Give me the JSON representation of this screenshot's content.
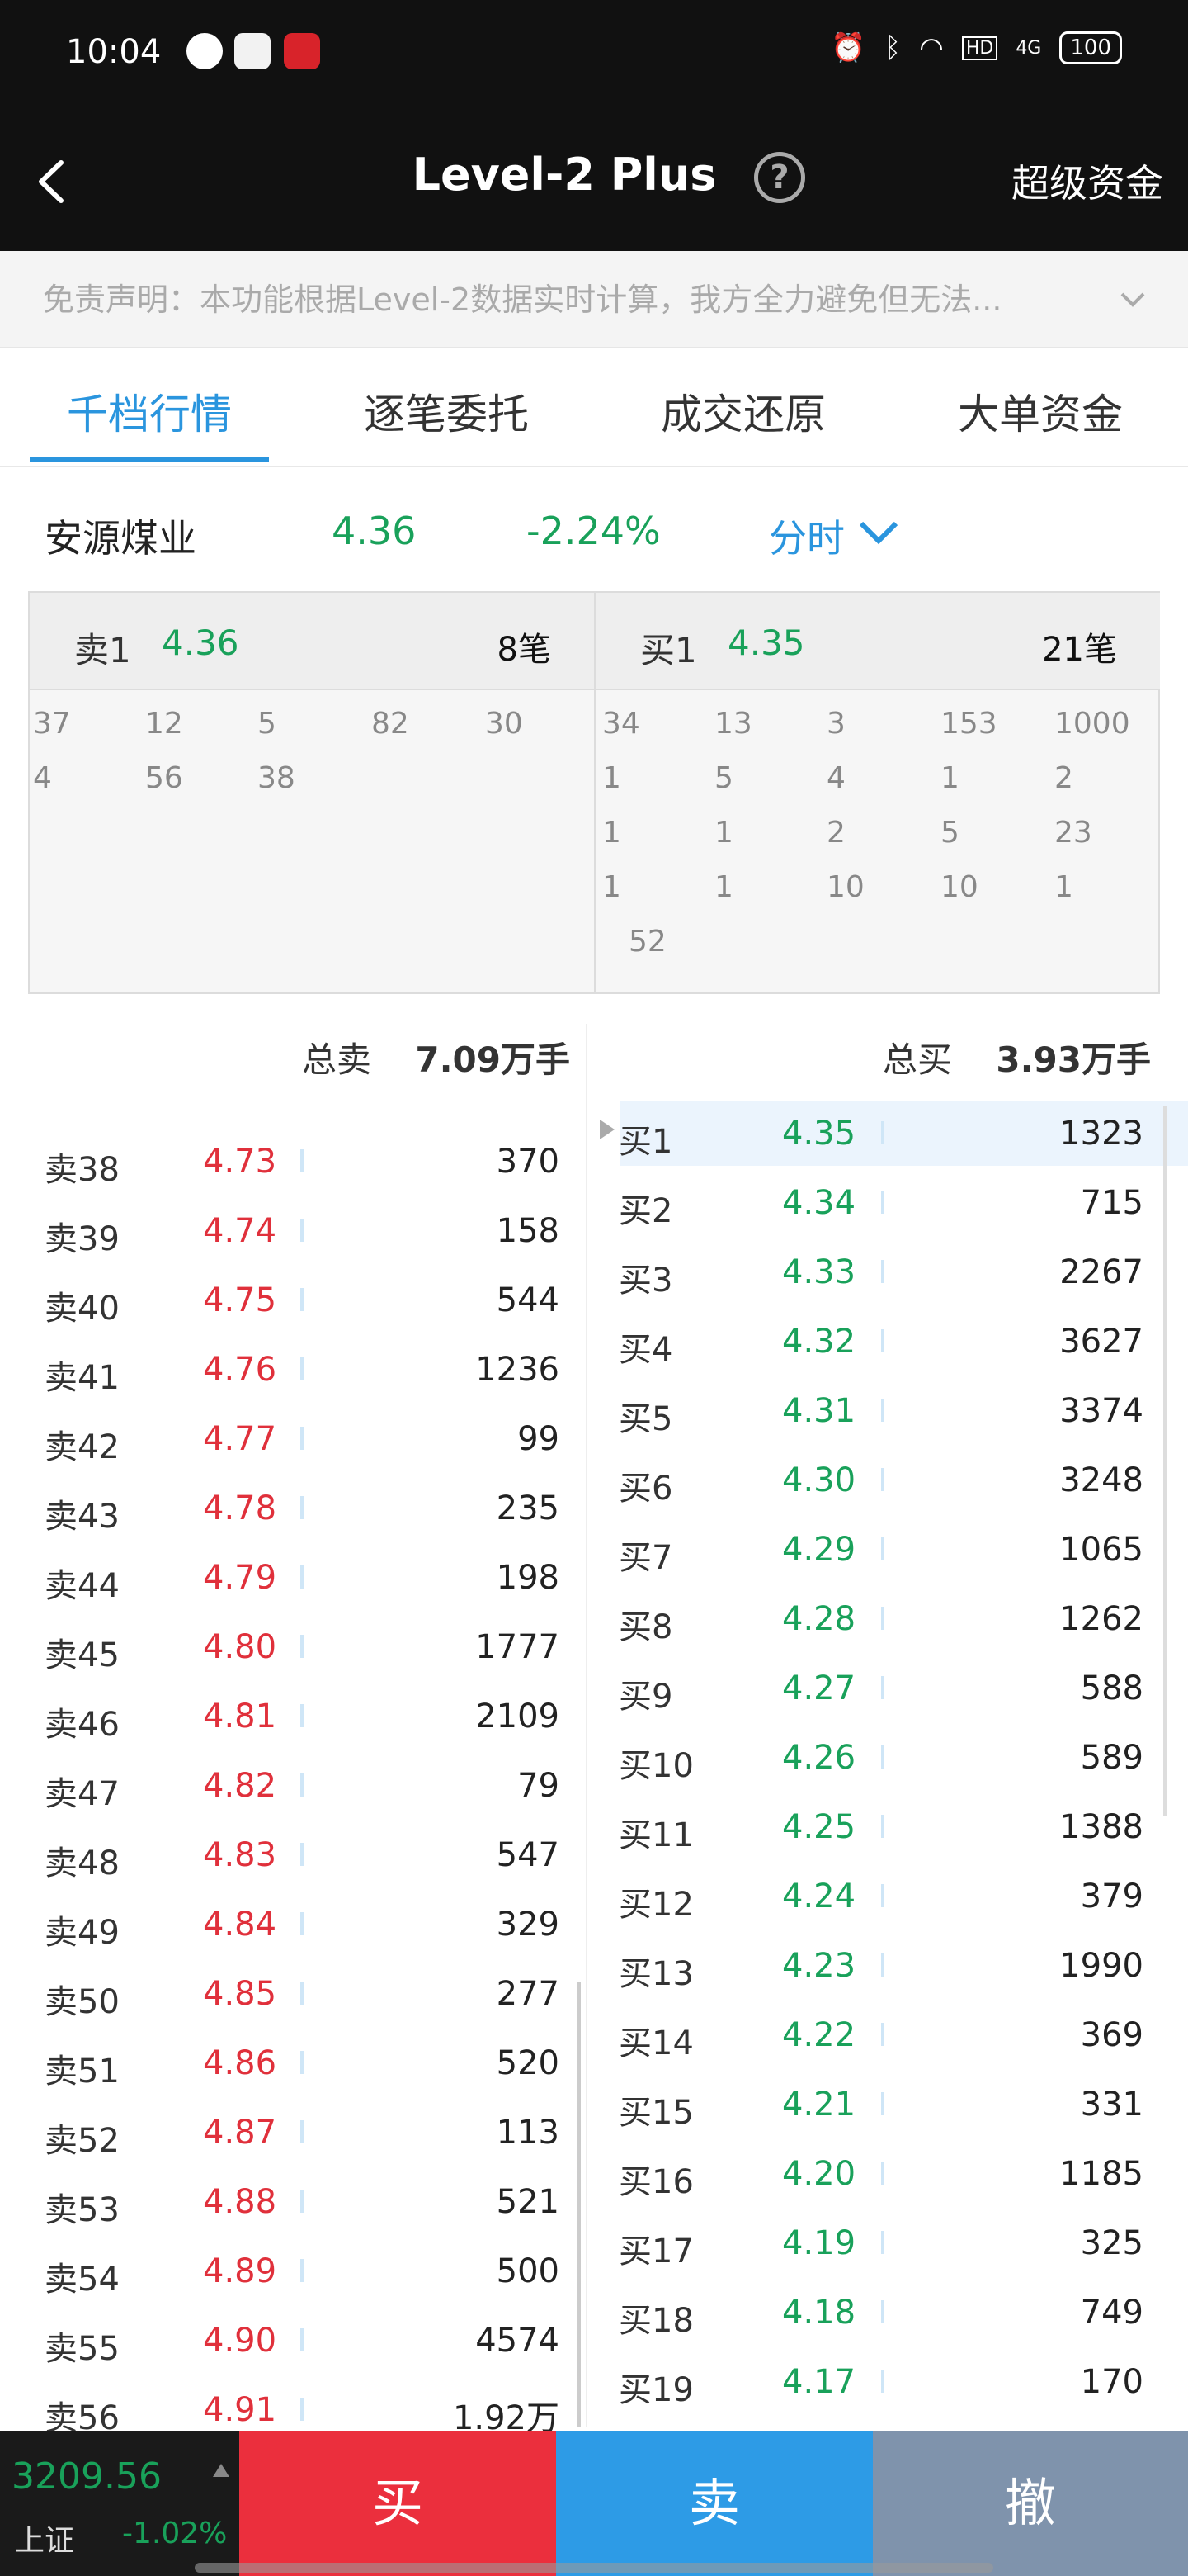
{
  "status_bar": {
    "time": "10:04",
    "battery": "100",
    "network": "4G",
    "hd": "HD"
  },
  "header": {
    "title": "Level-2 Plus",
    "help": "?",
    "right_link": "超级资金"
  },
  "disclaimer": "免责声明：本功能根据Level-2数据实时计算，我方全力避免但无法...",
  "tabs": [
    "千档行情",
    "逐笔委托",
    "成交还原",
    "大单资金"
  ],
  "active_tab": 0,
  "stock": {
    "name": "安源煤业",
    "price": "4.36",
    "change_pct": "-2.24%",
    "mode": "分时"
  },
  "queue": {
    "sell": {
      "label": "卖1",
      "price": "4.36",
      "count": "8笔",
      "orders": [
        "37",
        "12",
        "5",
        "82",
        "30",
        "4",
        "56",
        "38"
      ]
    },
    "buy": {
      "label": "买1",
      "price": "4.35",
      "count": "21笔",
      "orders": [
        "34",
        "13",
        "3",
        "153",
        "1000",
        "1",
        "5",
        "4",
        "1",
        "2",
        "1",
        "1",
        "2",
        "5",
        "23",
        "1",
        "1",
        "10",
        "10",
        "1",
        "52"
      ]
    }
  },
  "totals": {
    "sell_label": "总卖",
    "sell_value": "7.09万手",
    "buy_label": "总买",
    "buy_value": "3.93万手"
  },
  "asks": [
    {
      "label": "卖38",
      "price": "4.73",
      "vol": "370"
    },
    {
      "label": "卖39",
      "price": "4.74",
      "vol": "158"
    },
    {
      "label": "卖40",
      "price": "4.75",
      "vol": "544"
    },
    {
      "label": "卖41",
      "price": "4.76",
      "vol": "1236"
    },
    {
      "label": "卖42",
      "price": "4.77",
      "vol": "99"
    },
    {
      "label": "卖43",
      "price": "4.78",
      "vol": "235"
    },
    {
      "label": "卖44",
      "price": "4.79",
      "vol": "198"
    },
    {
      "label": "卖45",
      "price": "4.80",
      "vol": "1777"
    },
    {
      "label": "卖46",
      "price": "4.81",
      "vol": "2109"
    },
    {
      "label": "卖47",
      "price": "4.82",
      "vol": "79"
    },
    {
      "label": "卖48",
      "price": "4.83",
      "vol": "547"
    },
    {
      "label": "卖49",
      "price": "4.84",
      "vol": "329"
    },
    {
      "label": "卖50",
      "price": "4.85",
      "vol": "277"
    },
    {
      "label": "卖51",
      "price": "4.86",
      "vol": "520"
    },
    {
      "label": "卖52",
      "price": "4.87",
      "vol": "113"
    },
    {
      "label": "卖53",
      "price": "4.88",
      "vol": "521"
    },
    {
      "label": "卖54",
      "price": "4.89",
      "vol": "500"
    },
    {
      "label": "卖55",
      "price": "4.90",
      "vol": "4574"
    },
    {
      "label": "卖56",
      "price": "4.91",
      "vol": "1.92万"
    }
  ],
  "bids": [
    {
      "label": "买1",
      "price": "4.35",
      "vol": "1323"
    },
    {
      "label": "买2",
      "price": "4.34",
      "vol": "715"
    },
    {
      "label": "买3",
      "price": "4.33",
      "vol": "2267"
    },
    {
      "label": "买4",
      "price": "4.32",
      "vol": "3627"
    },
    {
      "label": "买5",
      "price": "4.31",
      "vol": "3374"
    },
    {
      "label": "买6",
      "price": "4.30",
      "vol": "3248"
    },
    {
      "label": "买7",
      "price": "4.29",
      "vol": "1065"
    },
    {
      "label": "买8",
      "price": "4.28",
      "vol": "1262"
    },
    {
      "label": "买9",
      "price": "4.27",
      "vol": "588"
    },
    {
      "label": "买10",
      "price": "4.26",
      "vol": "589"
    },
    {
      "label": "买11",
      "price": "4.25",
      "vol": "1388"
    },
    {
      "label": "买12",
      "price": "4.24",
      "vol": "379"
    },
    {
      "label": "买13",
      "price": "4.23",
      "vol": "1990"
    },
    {
      "label": "买14",
      "price": "4.22",
      "vol": "369"
    },
    {
      "label": "买15",
      "price": "4.21",
      "vol": "331"
    },
    {
      "label": "买16",
      "price": "4.20",
      "vol": "1185"
    },
    {
      "label": "买17",
      "price": "4.19",
      "vol": "325"
    },
    {
      "label": "买18",
      "price": "4.18",
      "vol": "749"
    },
    {
      "label": "买19",
      "price": "4.17",
      "vol": "170"
    }
  ],
  "index": {
    "value": "3209.56",
    "name": "上证",
    "change": "-1.02%"
  },
  "actions": {
    "buy": "买",
    "sell": "卖",
    "cancel": "撤"
  },
  "colors": {
    "up": "#e0303b",
    "down": "#19a15a",
    "accent": "#2a95de",
    "buy_btn": "#eb2f3d",
    "sell_btn": "#2d9be6",
    "cancel_btn": "#7f93ac"
  }
}
